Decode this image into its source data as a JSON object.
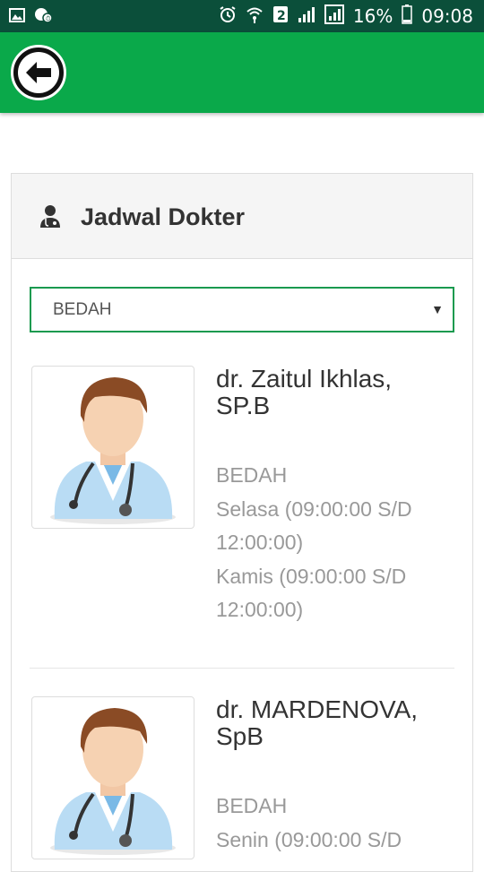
{
  "status_bar": {
    "battery_percent": "16%",
    "time": "09:08",
    "sim_slot": "2"
  },
  "app_bar": {
    "back_icon": "arrow-left-icon",
    "color": "#0aa94a"
  },
  "panel": {
    "icon": "doctor-icon",
    "title": "Jadwal Dokter"
  },
  "filter": {
    "selected": "BEDAH"
  },
  "doctors": [
    {
      "name_line1": "dr. Zaitul Ikhlas,",
      "name_line2": "SP.B",
      "specialty": "BEDAH",
      "schedule": [
        {
          "line1": "Selasa (09:00:00 S/D",
          "line2": "12:00:00)"
        },
        {
          "line1": "Kamis (09:00:00 S/D",
          "line2": "12:00:00)"
        }
      ]
    },
    {
      "name_line1": "dr. MARDENOVA,",
      "name_line2": "SpB",
      "specialty": "BEDAH",
      "schedule": [
        {
          "line1": "Senin (09:00:00 S/D",
          "line2": ""
        }
      ]
    }
  ]
}
